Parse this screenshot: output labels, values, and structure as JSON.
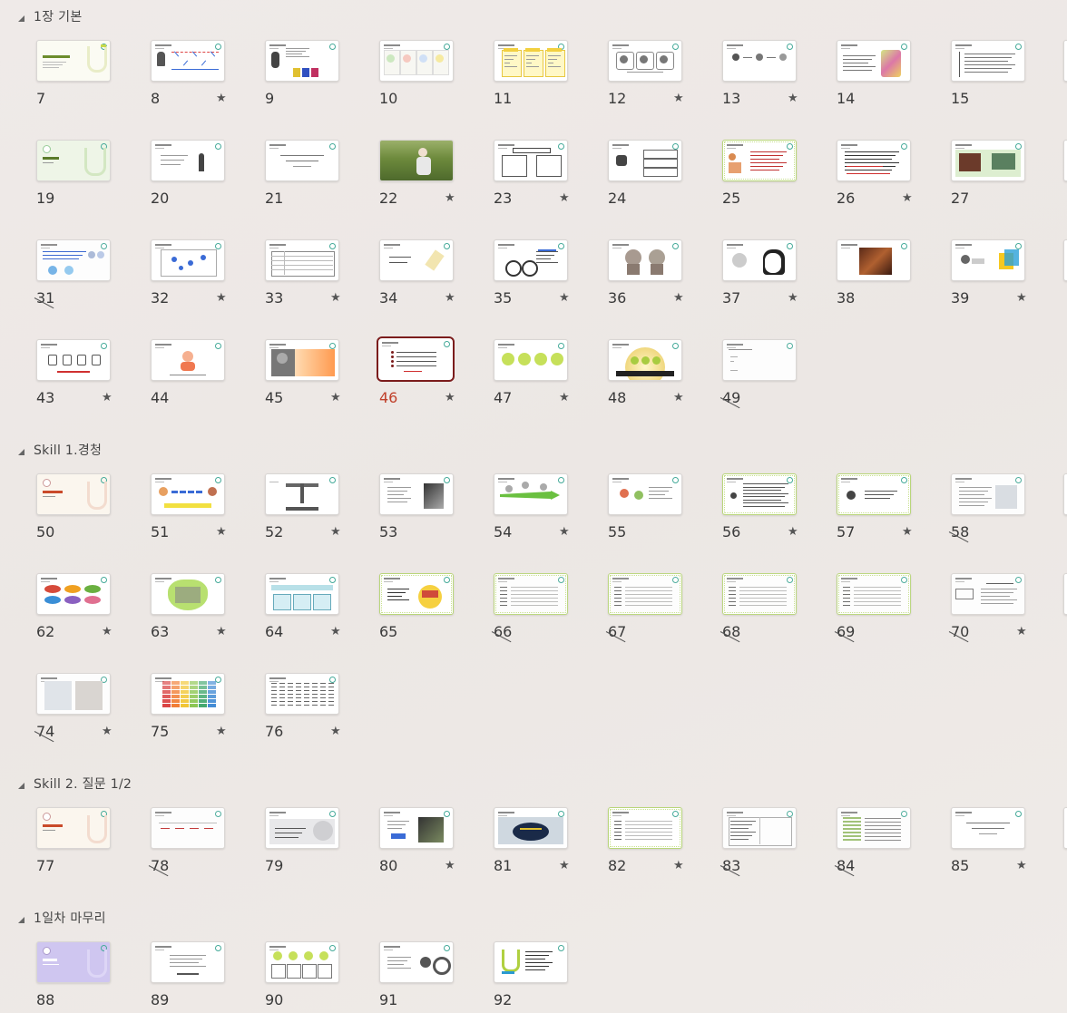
{
  "sections": [
    {
      "title": "1장 기본",
      "slides": [
        {
          "n": "7",
          "star": false,
          "hidden": false,
          "selected": false,
          "style": "cover-yellow"
        },
        {
          "n": "8",
          "star": true,
          "hidden": false,
          "selected": false,
          "style": "person-chart"
        },
        {
          "n": "9",
          "star": false,
          "hidden": false,
          "selected": false,
          "style": "person-bars"
        },
        {
          "n": "10",
          "star": false,
          "hidden": false,
          "selected": false,
          "style": "three-circles"
        },
        {
          "n": "11",
          "star": false,
          "hidden": false,
          "selected": false,
          "style": "yellow-cards"
        },
        {
          "n": "12",
          "star": true,
          "hidden": false,
          "selected": false,
          "style": "icon-boxes"
        },
        {
          "n": "13",
          "star": true,
          "hidden": false,
          "selected": false,
          "style": "arrows-icons"
        },
        {
          "n": "14",
          "star": false,
          "hidden": false,
          "selected": false,
          "style": "text-who"
        },
        {
          "n": "15",
          "star": false,
          "hidden": false,
          "selected": false,
          "style": "text-list"
        },
        {
          "n": "19",
          "star": false,
          "hidden": false,
          "selected": false,
          "style": "cover-green"
        },
        {
          "n": "20",
          "star": false,
          "hidden": false,
          "selected": false,
          "style": "person-text"
        },
        {
          "n": "21",
          "star": false,
          "hidden": false,
          "selected": false,
          "style": "text-center"
        },
        {
          "n": "22",
          "star": true,
          "hidden": false,
          "selected": false,
          "style": "photo-field"
        },
        {
          "n": "23",
          "star": true,
          "hidden": false,
          "selected": false,
          "style": "vs-boxes"
        },
        {
          "n": "24",
          "star": false,
          "hidden": false,
          "selected": false,
          "style": "speaker-boxes"
        },
        {
          "n": "25",
          "star": false,
          "hidden": false,
          "selected": false,
          "style": "green-people"
        },
        {
          "n": "26",
          "star": true,
          "hidden": false,
          "selected": false,
          "style": "text-red"
        },
        {
          "n": "27",
          "star": false,
          "hidden": false,
          "selected": false,
          "style": "green-photos"
        },
        {
          "n": "31",
          "star": false,
          "hidden": true,
          "selected": false,
          "style": "bubbles-blue"
        },
        {
          "n": "32",
          "star": true,
          "hidden": false,
          "selected": false,
          "style": "blue-diagram"
        },
        {
          "n": "33",
          "star": true,
          "hidden": false,
          "selected": false,
          "style": "table-lines"
        },
        {
          "n": "34",
          "star": true,
          "hidden": false,
          "selected": false,
          "style": "text-pencil"
        },
        {
          "n": "35",
          "star": true,
          "hidden": false,
          "selected": false,
          "style": "bicycle"
        },
        {
          "n": "36",
          "star": true,
          "hidden": false,
          "selected": false,
          "style": "two-heads"
        },
        {
          "n": "37",
          "star": true,
          "hidden": false,
          "selected": false,
          "style": "sketch-faces"
        },
        {
          "n": "38",
          "star": false,
          "hidden": false,
          "selected": false,
          "style": "painting"
        },
        {
          "n": "39",
          "star": true,
          "hidden": false,
          "selected": false,
          "style": "cube"
        },
        {
          "n": "43",
          "star": true,
          "hidden": false,
          "selected": false,
          "style": "up-arrows"
        },
        {
          "n": "44",
          "star": false,
          "hidden": false,
          "selected": false,
          "style": "child-icon"
        },
        {
          "n": "45",
          "star": true,
          "hidden": false,
          "selected": false,
          "style": "orange-photo"
        },
        {
          "n": "46",
          "star": true,
          "hidden": false,
          "selected": true,
          "style": "red-list"
        },
        {
          "n": "47",
          "star": true,
          "hidden": false,
          "selected": false,
          "style": "green-dots"
        },
        {
          "n": "48",
          "star": true,
          "hidden": false,
          "selected": false,
          "style": "gold-stage"
        },
        {
          "n": "49",
          "star": false,
          "hidden": true,
          "selected": false,
          "style": "plain-list"
        }
      ]
    },
    {
      "title": "Skill 1.경청",
      "slides": [
        {
          "n": "50",
          "star": false,
          "hidden": false,
          "selected": false,
          "style": "cover-red"
        },
        {
          "n": "51",
          "star": true,
          "hidden": false,
          "selected": false,
          "style": "yellow-people"
        },
        {
          "n": "52",
          "star": true,
          "hidden": false,
          "selected": false,
          "style": "kanji"
        },
        {
          "n": "53",
          "star": false,
          "hidden": false,
          "selected": false,
          "style": "text-face"
        },
        {
          "n": "54",
          "star": true,
          "hidden": false,
          "selected": false,
          "style": "green-arrow"
        },
        {
          "n": "55",
          "star": false,
          "hidden": false,
          "selected": false,
          "style": "two-people"
        },
        {
          "n": "56",
          "star": true,
          "hidden": false,
          "selected": false,
          "style": "green-text-icon"
        },
        {
          "n": "57",
          "star": true,
          "hidden": false,
          "selected": false,
          "style": "green-icon-list"
        },
        {
          "n": "58",
          "star": false,
          "hidden": true,
          "selected": false,
          "style": "text-photo"
        },
        {
          "n": "62",
          "star": true,
          "hidden": false,
          "selected": false,
          "style": "color-ovals"
        },
        {
          "n": "63",
          "star": true,
          "hidden": false,
          "selected": false,
          "style": "green-heart"
        },
        {
          "n": "64",
          "star": true,
          "hidden": false,
          "selected": false,
          "style": "teal-boxes"
        },
        {
          "n": "65",
          "star": false,
          "hidden": false,
          "selected": false,
          "style": "case-study"
        },
        {
          "n": "66",
          "star": false,
          "hidden": true,
          "selected": false,
          "style": "green-text"
        },
        {
          "n": "67",
          "star": false,
          "hidden": true,
          "selected": false,
          "style": "green-text"
        },
        {
          "n": "68",
          "star": false,
          "hidden": true,
          "selected": false,
          "style": "green-text"
        },
        {
          "n": "69",
          "star": false,
          "hidden": true,
          "selected": false,
          "style": "green-text"
        },
        {
          "n": "70",
          "star": true,
          "hidden": true,
          "selected": false,
          "style": "box-list"
        },
        {
          "n": "74",
          "star": true,
          "hidden": true,
          "selected": false,
          "style": "two-photos"
        },
        {
          "n": "75",
          "star": true,
          "hidden": false,
          "selected": false,
          "style": "color-grid"
        },
        {
          "n": "76",
          "star": true,
          "hidden": false,
          "selected": false,
          "style": "dense-table"
        }
      ]
    },
    {
      "title": "Skill 2. 질문 1/2",
      "slides": [
        {
          "n": "77",
          "star": false,
          "hidden": false,
          "selected": false,
          "style": "cover-red"
        },
        {
          "n": "78",
          "star": false,
          "hidden": true,
          "selected": false,
          "style": "four-cols"
        },
        {
          "n": "79",
          "star": false,
          "hidden": false,
          "selected": false,
          "style": "gray-q"
        },
        {
          "n": "80",
          "star": true,
          "hidden": false,
          "selected": false,
          "style": "gorilla"
        },
        {
          "n": "81",
          "star": true,
          "hidden": false,
          "selected": false,
          "style": "dark-oval"
        },
        {
          "n": "82",
          "star": true,
          "hidden": false,
          "selected": false,
          "style": "green-text"
        },
        {
          "n": "83",
          "star": false,
          "hidden": true,
          "selected": false,
          "style": "doc-table"
        },
        {
          "n": "84",
          "star": false,
          "hidden": true,
          "selected": false,
          "style": "green-table"
        },
        {
          "n": "85",
          "star": true,
          "hidden": false,
          "selected": false,
          "style": "text-center"
        }
      ]
    },
    {
      "title": "1일차 마무리",
      "slides": [
        {
          "n": "88",
          "star": false,
          "hidden": false,
          "selected": false,
          "style": "cover-purple"
        },
        {
          "n": "89",
          "star": false,
          "hidden": false,
          "selected": false,
          "style": "text-list-center"
        },
        {
          "n": "90",
          "star": false,
          "hidden": false,
          "selected": false,
          "style": "green-dots-boxes"
        },
        {
          "n": "91",
          "star": false,
          "hidden": false,
          "selected": false,
          "style": "target-icon"
        },
        {
          "n": "92",
          "star": false,
          "hidden": false,
          "selected": false,
          "style": "ace-end"
        }
      ]
    }
  ],
  "icons": {
    "star": "★",
    "collapse": "collapse-triangle-icon"
  },
  "colors": {
    "selected_border": "#7b1c1c",
    "selected_number": "#c0402a"
  }
}
